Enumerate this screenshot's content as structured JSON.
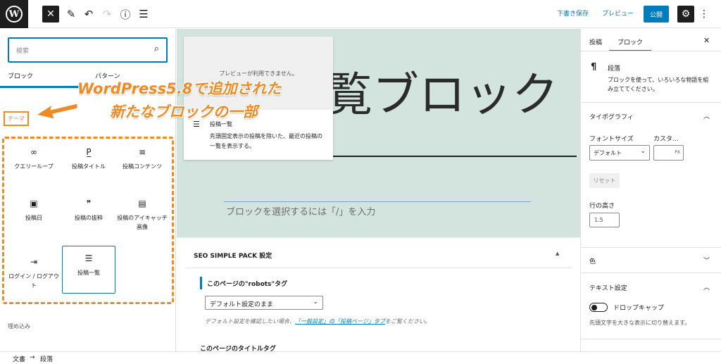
{
  "toolbar": {
    "save_draft": "下書き保存",
    "preview": "プレビュー",
    "publish": "公開",
    "close_glyph": "✕"
  },
  "inserter": {
    "search_placeholder": "検索",
    "tabs": [
      "ブロック",
      "パターン"
    ],
    "category_label": "テーマ",
    "blocks": [
      {
        "icon": "∞",
        "label": "クエリーループ"
      },
      {
        "icon": "P̲",
        "label": "投稿タイトル"
      },
      {
        "icon": "≡",
        "label": "投稿コンテンツ"
      },
      {
        "icon": "▣",
        "label": "投稿日"
      },
      {
        "icon": "❞",
        "label": "投稿の抜粋"
      },
      {
        "icon": "▤",
        "label": "投稿のアイキャッチ画像"
      },
      {
        "icon": "⇥",
        "label": "ログイン / ログアウト"
      },
      {
        "icon": "☰",
        "label": "投稿一覧"
      }
    ],
    "next_category": "埋め込み"
  },
  "annotation": {
    "line1": "WordPress5.8で追加された",
    "line2": "新たなブロックの一部",
    "color": "#f08a24"
  },
  "canvas": {
    "title_visible": "覧ブロック",
    "paragraph_placeholder": "ブロックを選択するには「/」を入力",
    "preview_popup": {
      "unavailable": "プレビューが利用できません。",
      "block_name": "投稿一覧",
      "block_desc": "先頭固定表示の投稿を除いた、最近の投稿の一覧を表示する。"
    },
    "seo": {
      "heading": "SEO SIMPLE PACK 設定",
      "robots_label": "このページの\"robots\"タグ",
      "robots_value": "デフォルト設定のまま",
      "help_prefix": "デフォルト設定を確認したい場合、",
      "help_link1": "「一般設定」の「投稿ページ」タブ",
      "help_suffix": "をご覧ください。",
      "next_label": "このページのタイトルタグ"
    }
  },
  "sidebar": {
    "tabs": [
      "投稿",
      "ブロック"
    ],
    "block_name": "段落",
    "block_desc": "ブロックを使って、いろいろな物語を組み立ててください。",
    "typography": "タイポグラフィ",
    "font_size_label": "フォントサイズ",
    "custom_label": "カスタ...",
    "font_size_value": "デフォルト",
    "px_unit": "PX",
    "reset": "リセット",
    "line_height_label": "行の高さ",
    "line_height_value": "1.5",
    "color_section": "色",
    "text_settings": "テキスト設定",
    "drop_cap": "ドロップキャップ",
    "drop_cap_help": "先頭文字を大きな表示に切り替えます。"
  },
  "footer": {
    "crumb1": "文書",
    "crumb2": "段落"
  },
  "colors": {
    "accent": "#007cba",
    "dark": "#1e1e1e",
    "annotation": "#f08a24",
    "canvas_bg": "#d3e3de"
  }
}
